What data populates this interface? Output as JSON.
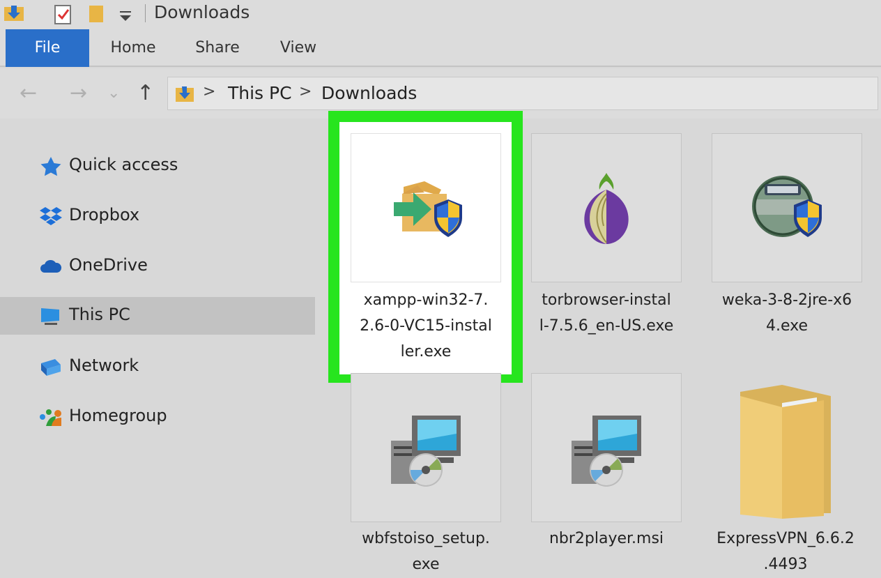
{
  "window": {
    "title": "Downloads"
  },
  "ribbon": {
    "tabs": [
      "File",
      "Home",
      "Share",
      "View"
    ],
    "active": "File"
  },
  "address": {
    "path": [
      "This PC",
      "Downloads"
    ],
    "separator": ">"
  },
  "nav_glyphs": {
    "back": "←",
    "forward": "→",
    "recent": "⌄",
    "up": "↑"
  },
  "sidebar": {
    "items": [
      {
        "label": "Quick access",
        "icon": "star-icon"
      },
      {
        "label": "Dropbox",
        "icon": "dropbox-icon"
      },
      {
        "label": "OneDrive",
        "icon": "cloud-icon"
      },
      {
        "label": "This PC",
        "icon": "computer-icon",
        "selected": true
      },
      {
        "label": "Network",
        "icon": "network-icon"
      },
      {
        "label": "Homegroup",
        "icon": "homegroup-icon"
      }
    ]
  },
  "files": [
    {
      "name_lines": [
        "xampp-win32-7.",
        "2.6-0-VC15-instal",
        "ler.exe"
      ],
      "icon": "installer-box-shield-icon",
      "highlighted": true
    },
    {
      "name_lines": [
        "torbrowser-instal",
        "l-7.5.6_en-US.exe"
      ],
      "icon": "tor-onion-icon"
    },
    {
      "name_lines": [
        "weka-3-8-2jre-x6",
        "4.exe"
      ],
      "icon": "nsis-installer-shield-icon"
    },
    {
      "name_lines": [
        "wbfstoiso_setup.",
        "exe"
      ],
      "icon": "setup-computer-disc-icon"
    },
    {
      "name_lines": [
        "nbr2player.msi"
      ],
      "icon": "setup-computer-disc-icon"
    },
    {
      "name_lines": [
        "ExpressVPN_6.6.2",
        ".4493"
      ],
      "icon": "folder-icon"
    }
  ],
  "colors": {
    "accent": "#2a6fc9",
    "highlight": "#27e51e",
    "selected_nav": "#c2c2c2"
  }
}
